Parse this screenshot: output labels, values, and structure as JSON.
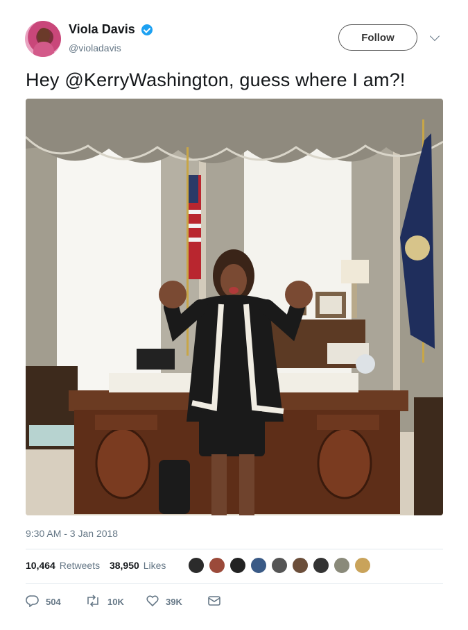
{
  "author": {
    "name": "Viola Davis",
    "handle": "@violadavis",
    "verified": true,
    "avatar_icon": "avatar-photo"
  },
  "header": {
    "follow_label": "Follow",
    "menu_icon": "chevron-down-icon"
  },
  "tweet": {
    "text": "Hey @KerryWashington, guess where I am?!",
    "media_icon": "photo-oval-office",
    "timestamp": "9:30 AM - 3 Jan 2018"
  },
  "stats": {
    "retweets_count": "10,464",
    "retweets_label": "Retweets",
    "likes_count": "38,950",
    "likes_label": "Likes"
  },
  "actions": {
    "reply_count": "504",
    "retweet_count": "10K",
    "like_count": "39K"
  },
  "colors": {
    "accent": "#1da1f2",
    "muted": "#657786",
    "text": "#14171a"
  }
}
